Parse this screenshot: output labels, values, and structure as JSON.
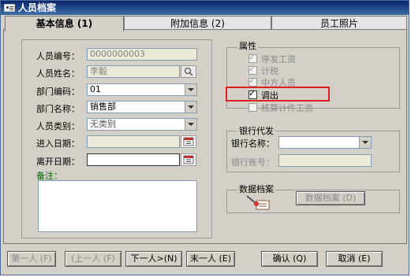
{
  "window": {
    "title": "人员档案"
  },
  "tabs": [
    {
      "label": "基本信息 (1)"
    },
    {
      "label": "附加信息 (2)"
    },
    {
      "label": "员工照片"
    }
  ],
  "basic": {
    "employee_no": {
      "label": "人员编号：",
      "value": "0000000003"
    },
    "employee_name": {
      "label": "人员姓名：",
      "value": "李毅"
    },
    "dept_code": {
      "label": "部门编码：",
      "value": "01"
    },
    "dept_name": {
      "label": "部门名称：",
      "value": "销售部"
    },
    "employee_type": {
      "label": "人员类别：",
      "value": "无类别"
    },
    "entry_date": {
      "label": "进入日期：",
      "value": ""
    },
    "leave_date": {
      "label": "离开日期：",
      "value": ""
    },
    "remark": {
      "label": "备注："
    }
  },
  "attributes": {
    "title": "属性",
    "items": [
      {
        "label": "停发工资",
        "checked": true,
        "enabled": false
      },
      {
        "label": "计税",
        "checked": true,
        "enabled": false
      },
      {
        "label": "中方人员",
        "checked": true,
        "enabled": false
      },
      {
        "label": "调出",
        "checked": true,
        "enabled": true
      },
      {
        "label": "核算计件工资",
        "checked": false,
        "enabled": false
      }
    ]
  },
  "bank": {
    "title": "银行代发",
    "bank_name_label": "银行名称：",
    "bank_account_label": "银行账号：",
    "bank_name_value": "",
    "bank_account_value": ""
  },
  "data_archive": {
    "title": "数据档案",
    "button_label": "数据档案 (D)"
  },
  "footer": {
    "first": "第一人 (F)",
    "prev": "(上一人 (F)",
    "next": "下一人>(N)",
    "last": "末一人 (E)",
    "ok": "确认 (Q)",
    "cancel": "取消 (E)"
  },
  "colors": {
    "titlebar": "#0a246a",
    "highlight": "#e02020",
    "window_bg": "#d4d0c8"
  }
}
